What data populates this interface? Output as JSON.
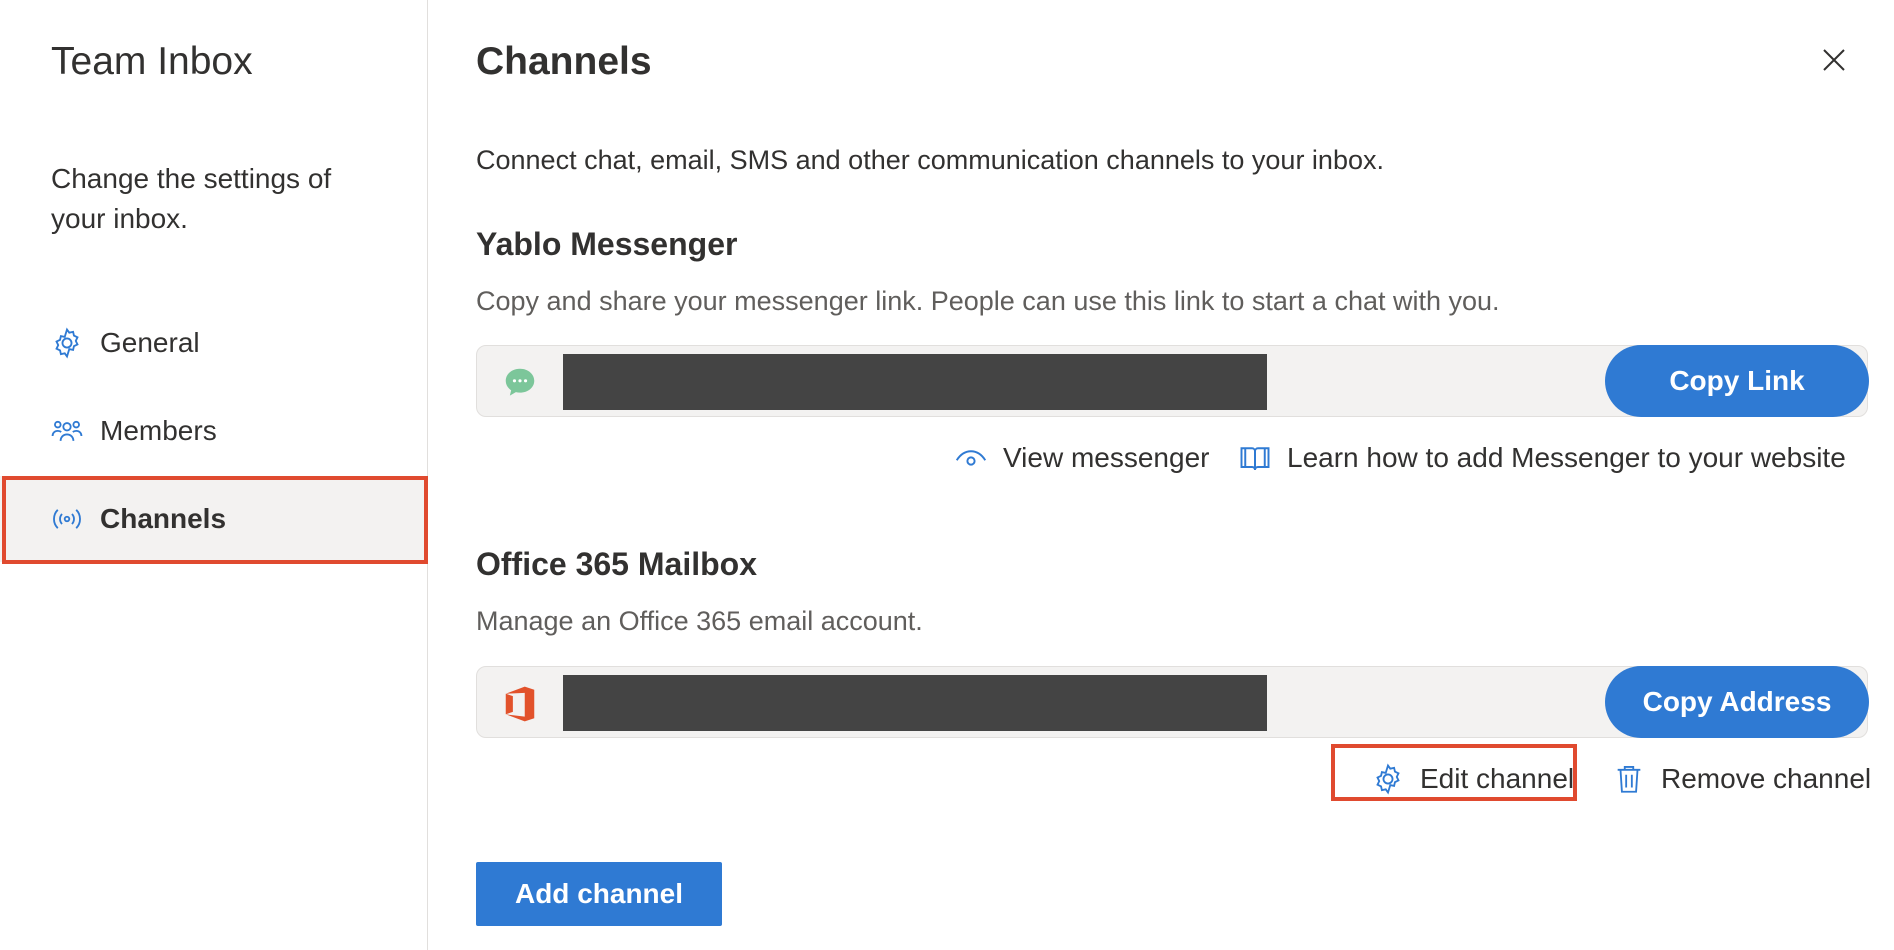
{
  "sidebar": {
    "title": "Team Inbox",
    "description": "Change the settings of your inbox.",
    "items": [
      {
        "label": "General",
        "icon": "gear-icon"
      },
      {
        "label": "Members",
        "icon": "people-icon"
      },
      {
        "label": "Channels",
        "icon": "broadcast-icon",
        "active": true
      }
    ]
  },
  "main": {
    "title": "Channels",
    "intro": "Connect chat, email, SMS and other communication channels to your inbox.",
    "messenger": {
      "title": "Yablo Messenger",
      "description": "Copy and share your messenger link. People can use this link to start a chat with you.",
      "copy_label": "Copy Link",
      "view_label": "View messenger",
      "learn_label": "Learn how to add Messenger to your website"
    },
    "mailbox": {
      "title": "Office 365 Mailbox",
      "description": "Manage an Office 365 email account.",
      "copy_label": "Copy Address",
      "edit_label": "Edit channel",
      "remove_label": "Remove channel"
    },
    "add_label": "Add channel"
  },
  "colors": {
    "accent": "#2f7ad3",
    "highlight": "#e04a2f",
    "messenger_icon": "#7cc69a",
    "office_icon": "#e2522b"
  }
}
